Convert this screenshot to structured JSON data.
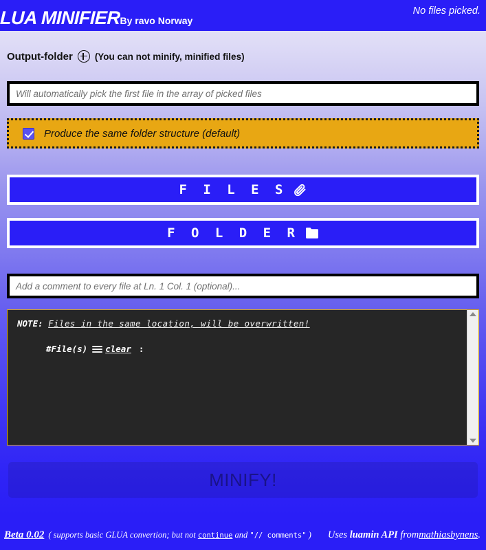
{
  "header": {
    "title": "LUA MINIFIER",
    "subtitle": "By ravo Norway",
    "status": "No files picked.",
    "bg_color": "#2a1ef7"
  },
  "output": {
    "label": "Output-folder",
    "add_icon": "plus-circle-icon",
    "hint": "(You can not minify, minified files)",
    "folder_input_placeholder": "Will automatically pick the first file in the array of picked files",
    "folder_input_value": ""
  },
  "structure_option": {
    "label": "Produce the same folder structure (default)",
    "checked": true,
    "bg_color": "#e8a713"
  },
  "buttons": {
    "files_label": "F I L E S",
    "files_icon": "paperclip-icon",
    "folder_label": "F O L D E R",
    "folder_icon": "folder-icon",
    "accent_color": "#2a1ef7"
  },
  "comment": {
    "placeholder": "Add a comment to every file at Ln. 1 Col. 1 (optional)...",
    "value": ""
  },
  "note": {
    "label": "NOTE:",
    "message": "Files in the same location, will be overwritten!",
    "files_label": "#File(s)",
    "menu_icon": "hamburger-icon",
    "clear_label": "clear",
    "colon": ":",
    "border_color": "#d9a81a",
    "bg_color": "#262626"
  },
  "minify": {
    "label": "MINIFY!",
    "enabled": false
  },
  "footer": {
    "beta_label": "Beta 0.02",
    "note_prefix": "( supports basic GLUA convertion; but not",
    "note_code1": "continue",
    "note_mid": "and",
    "note_code2": "\"// comments\"",
    "note_suffix": ")",
    "credit_prefix": "Uses",
    "credit_api": "luamin API",
    "credit_from": "from",
    "credit_author": "mathiasbynens",
    "credit_end": "."
  }
}
